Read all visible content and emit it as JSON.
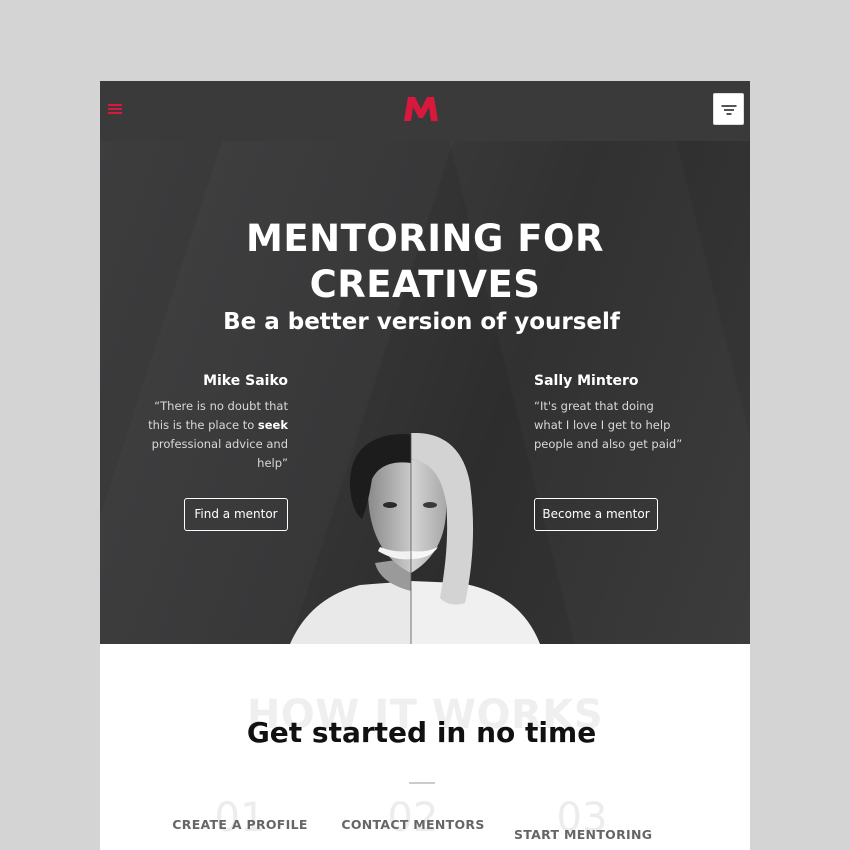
{
  "header": {
    "menu_icon": "hamburger-icon",
    "logo_icon": "m-logo-icon",
    "filter_icon": "filter-icon",
    "brand_color": "#d8183c"
  },
  "hero": {
    "title_line1": "MENTORING FOR",
    "title_line2": "CREATIVES",
    "subtitle": "Be a better version of yourself",
    "left": {
      "name": "Mike Saiko",
      "quote_before": "“There is no doubt that this is the place to ",
      "quote_bold": "seek",
      "quote_after": " professional advice and help”",
      "button": "Find a mentor"
    },
    "right": {
      "name": "Sally Mintero",
      "quote": "“It's great that doing what I love I get to help people and also get paid”",
      "button": "Become a mentor"
    }
  },
  "how": {
    "ghost_title": "HOW IT WORKS",
    "title": "Get started in no time",
    "steps": [
      {
        "num": "01",
        "label": "CREATE A PROFILE"
      },
      {
        "num": "02",
        "label": "CONTACT MENTORS"
      },
      {
        "num": "03",
        "label": "START MENTORING"
      }
    ]
  }
}
